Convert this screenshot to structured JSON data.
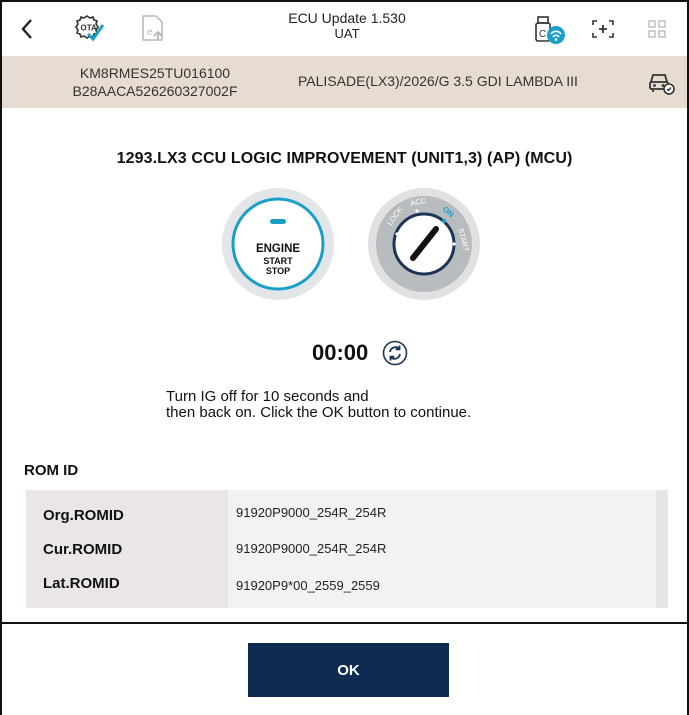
{
  "topbar": {
    "title": "ECU Update 1.530",
    "subtitle": "UAT",
    "back_icon": "chevron-left-icon",
    "icons": [
      "ota-check-icon",
      "document-upload-icon",
      "wireless-vci-icon",
      "screen-capture-icon",
      "grid-menu-icon"
    ]
  },
  "vehicle": {
    "vin": "KM8RMES25TU016100",
    "code": "B28AACA526260327002F",
    "model": "PALISADE(LX3)/2026/G 3.5 GDI LAMBDA III",
    "icon": "car-diagnostic-icon"
  },
  "main": {
    "heading": "1293.LX3 CCU LOGIC IMPROVEMENT (UNIT1,3) (AP) (MCU)",
    "engine_button": {
      "line1": "ENGINE",
      "line2": "START",
      "line3": "STOP"
    },
    "ignition": {
      "positions": [
        "LOCK",
        "ACC",
        "ON",
        "START"
      ],
      "active": "ON",
      "active_color": "#1aa0c8"
    },
    "timer": "00:00",
    "instructions": "Turn IG off for 10 seconds and\nthen back on. Click the OK button to continue."
  },
  "rom": {
    "label": "ROM ID",
    "rows": [
      {
        "key": "Org.ROMID",
        "value": "91920P9000_254R_254R"
      },
      {
        "key": "Cur.ROMID",
        "value": "91920P9000_254R_254R"
      },
      {
        "key": "Lat.ROMID",
        "value": "91920P9*00_2559_2559"
      }
    ]
  },
  "footer": {
    "ok_label": "OK"
  },
  "colors": {
    "vehicle_bar": "#e7dcd2",
    "ok_button": "#0f2b52",
    "accent": "#1aa0c8"
  }
}
